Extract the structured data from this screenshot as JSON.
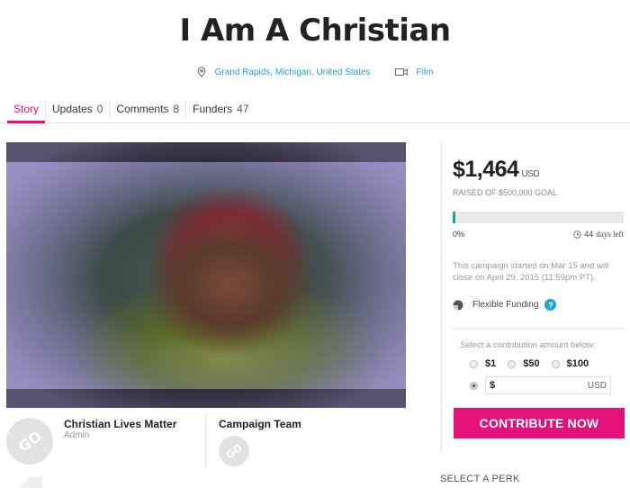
{
  "campaign": {
    "title": "I Am A Christian",
    "location": "Grand Rapids, Michigan, United States",
    "category": "Film"
  },
  "tabs": [
    {
      "label": "Story",
      "count": null
    },
    {
      "label": "Updates",
      "count": "0"
    },
    {
      "label": "Comments",
      "count": "8"
    },
    {
      "label": "Funders",
      "count": "47"
    }
  ],
  "owner": {
    "name": "Christian Lives Matter",
    "role": "Admin"
  },
  "team": {
    "title": "Campaign Team"
  },
  "funding": {
    "amount": "$1,464",
    "currency": "USD",
    "goal_text": "RAISED OF $500,000 GOAL",
    "percent": "0%",
    "progress_fraction": 0.003,
    "days_left_num": "44",
    "days_left_label": "days left",
    "dates_text": "This campaign started on Mar 15 and will close on April 29, 2015 (11:59pm PT).",
    "flexible_label": "Flexible Funding",
    "help_glyph": "?"
  },
  "contribution": {
    "prompt": "Select a contribution amount below:",
    "options": [
      "$1",
      "$50",
      "$100"
    ],
    "custom_symbol": "$",
    "custom_currency": "USD",
    "button_label": "CONTRIBUTE NOW"
  },
  "perk_heading": "SELECT A PERK",
  "badge_text": "GO",
  "colors": {
    "accent": "#e5117a",
    "link": "#1fa6c9",
    "progress": "#16a89a"
  },
  "icons": {
    "location": "location-pin-icon",
    "category": "film-camera-icon",
    "clock": "clock-icon",
    "funding": "half-circle-icon",
    "help": "help-icon"
  }
}
